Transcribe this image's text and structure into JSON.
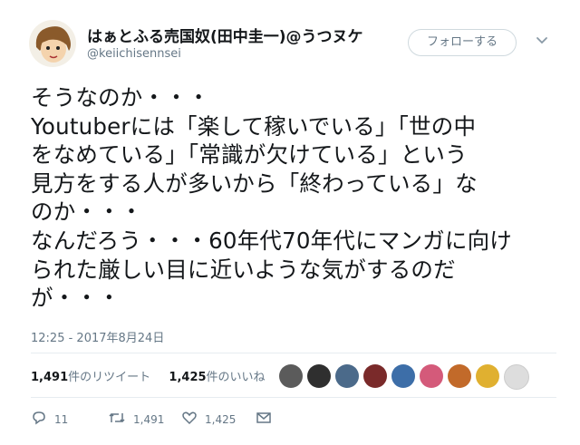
{
  "user": {
    "display_name": "はぁとふる売国奴(田中圭一)@うつヌケ",
    "handle": "@keiichisennsei",
    "follow_label": "フォローする"
  },
  "tweet": {
    "lines": [
      "そうなのか・・・",
      "Youtuberには「楽して稼いでいる」「世の中",
      "をなめている」「常識が欠けている」という",
      "見方をする人が多いから「終わっている」な",
      "のか・・・",
      "なんだろう・・・60年代70年代にマンガに向け",
      "られた厳しい目に近いような気がするのだ",
      "が・・・"
    ],
    "timestamp": "12:25 - 2017年8月24日"
  },
  "stats": {
    "retweet_count": "1,491",
    "retweet_label": "件のリツイート",
    "like_count": "1,425",
    "like_label": "件のいいね"
  },
  "liker_avatars": [
    "#5b5b5b",
    "#2f2f2f",
    "#4b6a8a",
    "#7a2a2a",
    "#3d6ea8",
    "#d45a7a",
    "#c26a2a",
    "#e0b030",
    "#dddddd"
  ],
  "actions": {
    "reply_count": "11",
    "retweet_count": "1,491",
    "like_count": "1,425"
  },
  "icons": {
    "reply": "reply-icon",
    "retweet": "retweet-icon",
    "like": "heart-icon",
    "dm": "envelope-icon",
    "caret": "chevron-down-icon"
  }
}
